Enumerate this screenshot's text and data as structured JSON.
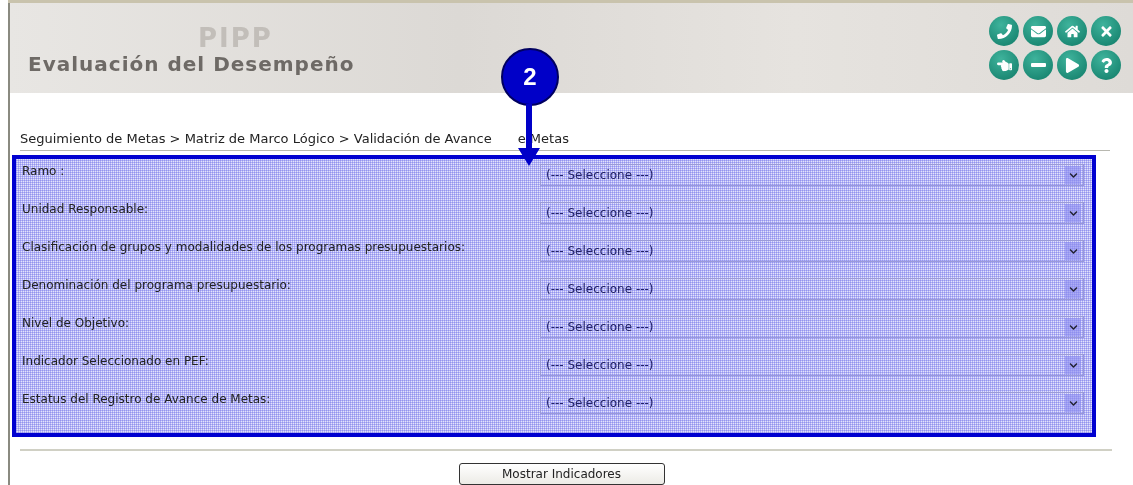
{
  "header": {
    "title": "Evaluación del Desempeño",
    "watermark": "PIPP"
  },
  "annotation": {
    "label": "2"
  },
  "breadcrumb": {
    "before": "Seguimiento de Metas > Matriz de Marco Lógico > Validación de Avance",
    "after": "e Metas"
  },
  "form": {
    "fields": [
      {
        "label": "Ramo :",
        "value": "(--- Seleccione ---)"
      },
      {
        "label": "Unidad Responsable:",
        "value": "(--- Seleccione ---)"
      },
      {
        "label": "Clasificación de grupos y modalidades de los programas presupuestarios:",
        "value": "(--- Seleccione ---)"
      },
      {
        "label": "Denominación del programa presupuestario:",
        "value": "(--- Seleccione ---)"
      },
      {
        "label": "Nivel de Objetivo:",
        "value": "(--- Seleccione ---)"
      },
      {
        "label": "Indicador Seleccionado en PEF:",
        "value": "(--- Seleccione ---)"
      },
      {
        "label": "Estatus del Registro de Avance de Metas:",
        "value": "(--- Seleccione ---)"
      }
    ]
  },
  "button": "Mostrar Indicadores"
}
